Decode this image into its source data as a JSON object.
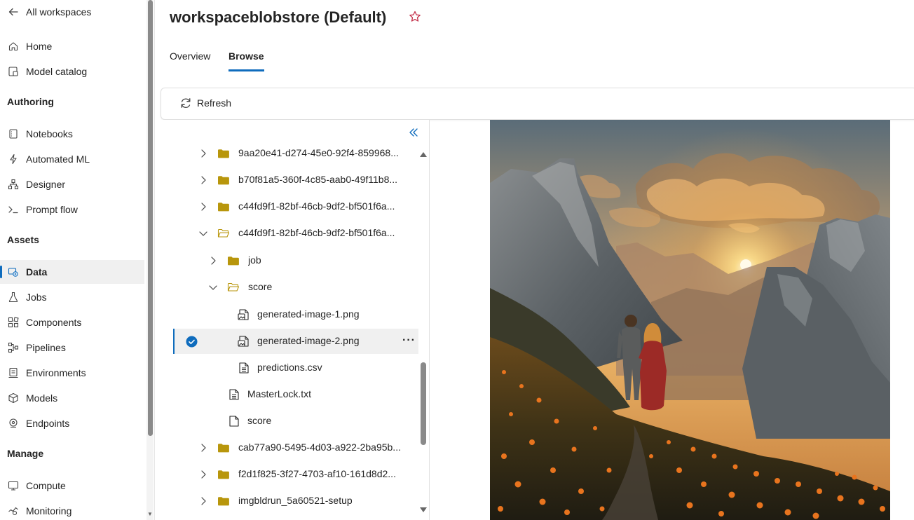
{
  "nav": {
    "back_label": "All workspaces",
    "items_top": [
      {
        "label": "Home",
        "icon": "home-icon"
      },
      {
        "label": "Model catalog",
        "icon": "model-catalog-icon"
      }
    ],
    "authoring": {
      "heading": "Authoring",
      "items": [
        {
          "label": "Notebooks",
          "icon": "notebook-icon"
        },
        {
          "label": "Automated ML",
          "icon": "automated-ml-icon"
        },
        {
          "label": "Designer",
          "icon": "designer-icon"
        },
        {
          "label": "Prompt flow",
          "icon": "prompt-flow-icon"
        }
      ]
    },
    "assets": {
      "heading": "Assets",
      "items": [
        {
          "label": "Data",
          "icon": "data-icon",
          "active": true
        },
        {
          "label": "Jobs",
          "icon": "jobs-icon"
        },
        {
          "label": "Components",
          "icon": "components-icon"
        },
        {
          "label": "Pipelines",
          "icon": "pipelines-icon"
        },
        {
          "label": "Environments",
          "icon": "environments-icon"
        },
        {
          "label": "Models",
          "icon": "models-icon"
        },
        {
          "label": "Endpoints",
          "icon": "endpoints-icon"
        }
      ]
    },
    "manage": {
      "heading": "Manage",
      "items": [
        {
          "label": "Compute",
          "icon": "compute-icon"
        },
        {
          "label": "Monitoring",
          "icon": "monitoring-icon"
        }
      ]
    }
  },
  "header": {
    "title": "workspaceblobstore (Default)",
    "tabs": [
      {
        "label": "Overview",
        "active": false
      },
      {
        "label": "Browse",
        "active": true
      }
    ]
  },
  "toolbar": {
    "refresh_label": "Refresh"
  },
  "tree": {
    "rows": [
      {
        "name": "9aa20e41-d274-45e0-92f4-859968...",
        "type": "folder",
        "expanded": false
      },
      {
        "name": "b70f81a5-360f-4c85-aab0-49f11b8...",
        "type": "folder",
        "expanded": false
      },
      {
        "name": "c44fd9f1-82bf-46cb-9df2-bf501f6a...",
        "type": "folder",
        "expanded": false
      },
      {
        "name": "c44fd9f1-82bf-46cb-9df2-bf501f6a...",
        "type": "folder-open",
        "expanded": true
      },
      {
        "name": "job",
        "type": "folder",
        "expanded": false
      },
      {
        "name": "score",
        "type": "folder-open",
        "expanded": true
      },
      {
        "name": "generated-image-1.png",
        "type": "image"
      },
      {
        "name": "generated-image-2.png",
        "type": "image",
        "selected": true
      },
      {
        "name": "predictions.csv",
        "type": "file"
      },
      {
        "name": "MasterLock.txt",
        "type": "file"
      },
      {
        "name": "score",
        "type": "blank-file"
      },
      {
        "name": "cab77a90-5495-4d03-a922-2ba95b...",
        "type": "folder",
        "expanded": false
      },
      {
        "name": "f2d1f825-3f27-4703-af10-161d8d2...",
        "type": "folder",
        "expanded": false
      },
      {
        "name": "imgbldrun_5a60521-setup",
        "type": "folder",
        "expanded": false
      }
    ]
  },
  "colors": {
    "accent": "#0f6cbd",
    "folder": "#b8960c",
    "active_bg": "#f0f0f0",
    "star": "#c4314b"
  }
}
